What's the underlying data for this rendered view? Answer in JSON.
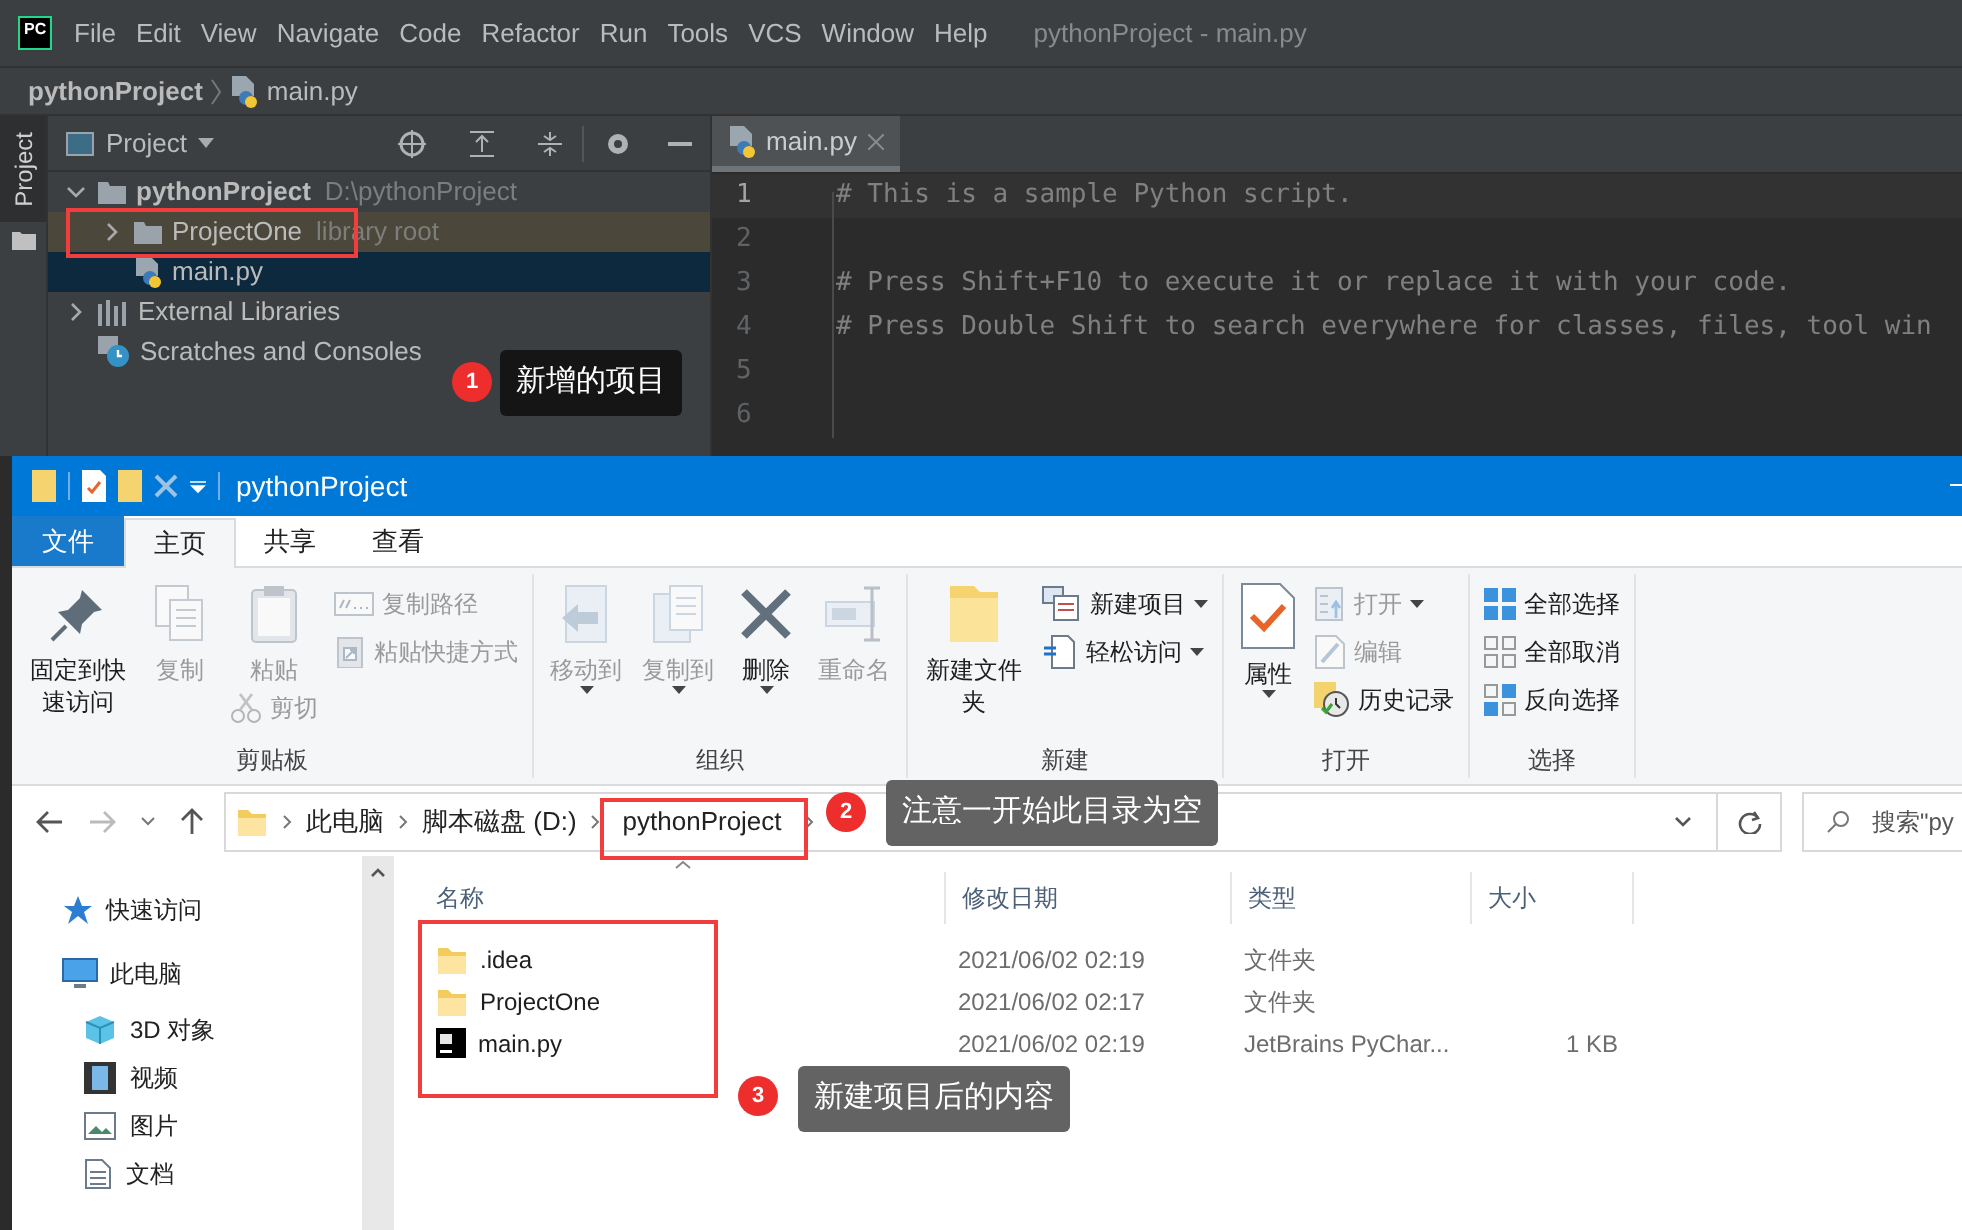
{
  "ide": {
    "logo": "PC",
    "menu": [
      "File",
      "Edit",
      "View",
      "Navigate",
      "Code",
      "Refactor",
      "Run",
      "Tools",
      "VCS",
      "Window",
      "Help"
    ],
    "title": "pythonProject - main.py",
    "breadcrumb": {
      "project": "pythonProject",
      "file": "main.py"
    },
    "side_tab": "Project",
    "project_panel": {
      "title": "Project",
      "tree": [
        {
          "label": "pythonProject",
          "hint": "D:\\pythonProject",
          "kind": "folder",
          "expanded": true,
          "selected": false,
          "highlighted": false,
          "children": [
            {
              "label": "ProjectOne",
              "hint": "library root",
              "kind": "folder",
              "expanded": false,
              "selected": false,
              "highlighted": true
            },
            {
              "label": "main.py",
              "kind": "python",
              "selected": true,
              "highlighted": false
            }
          ]
        },
        {
          "label": "External Libraries",
          "kind": "libraries",
          "expanded": false,
          "selected": false,
          "highlighted": false
        },
        {
          "label": "Scratches and Consoles",
          "kind": "scratches",
          "selected": false,
          "highlighted": false
        }
      ]
    },
    "editor": {
      "tab": "main.py",
      "lines": [
        {
          "number": "1",
          "code": "# This is a sample Python script.",
          "current": true
        },
        {
          "number": "2",
          "current": false
        },
        {
          "number": "3",
          "code": "# Press Shift+F10 to execute it or replace it with your code.",
          "current": false
        },
        {
          "number": "4",
          "code": "# Press Double Shift to search everywhere for classes, files, tool win",
          "current": false
        },
        {
          "number": "5",
          "current": false
        },
        {
          "number": "6",
          "current": false
        }
      ]
    }
  },
  "explorer": {
    "title": "pythonProject",
    "ribbon_tabs": [
      {
        "label": "文件",
        "kind": "menu",
        "selected": false
      },
      {
        "label": "主页",
        "kind": "tab",
        "selected": true
      },
      {
        "label": "共享",
        "kind": "tab",
        "selected": false
      },
      {
        "label": "查看",
        "kind": "tab",
        "selected": false
      }
    ],
    "ribbon_groups": [
      {
        "label": "剪贴板",
        "items": [
          {
            "label": "固定到快速访问",
            "kind": "large",
            "disabled": false
          },
          {
            "label": "复制",
            "kind": "large",
            "disabled": true
          },
          {
            "label": "粘贴",
            "kind": "large",
            "disabled": true
          },
          {
            "label": "剪切",
            "kind": "under",
            "disabled": true
          },
          {
            "label": "复制路径",
            "kind": "small",
            "disabled": true
          },
          {
            "label": "粘贴快捷方式",
            "kind": "small",
            "disabled": true
          }
        ]
      },
      {
        "label": "组织",
        "items": [
          {
            "label": "移动到",
            "kind": "large",
            "disabled": true,
            "dropdown": true
          },
          {
            "label": "复制到",
            "kind": "large",
            "disabled": true,
            "dropdown": true
          },
          {
            "label": "删除",
            "kind": "large",
            "disabled": false,
            "dropdown": true
          },
          {
            "label": "重命名",
            "kind": "large",
            "disabled": true
          }
        ]
      },
      {
        "label": "新建",
        "items": [
          {
            "label": "新建文件夹",
            "kind": "large",
            "disabled": false
          },
          {
            "label": "新建项目",
            "kind": "small",
            "disabled": false,
            "dropdown": true
          },
          {
            "label": "轻松访问",
            "kind": "small",
            "disabled": false,
            "dropdown": true
          }
        ]
      },
      {
        "label": "打开",
        "items": [
          {
            "label": "属性",
            "kind": "large",
            "disabled": false,
            "dropdown": true
          },
          {
            "label": "打开",
            "kind": "small",
            "disabled": true,
            "dropdown": true
          },
          {
            "label": "编辑",
            "kind": "small",
            "disabled": true
          },
          {
            "label": "历史记录",
            "kind": "small",
            "disabled": false
          }
        ]
      },
      {
        "label": "选择",
        "items": [
          {
            "label": "全部选择",
            "kind": "small",
            "disabled": false
          },
          {
            "label": "全部取消",
            "kind": "small",
            "disabled": false
          },
          {
            "label": "反向选择",
            "kind": "small",
            "disabled": false
          }
        ]
      }
    ],
    "address": [
      "此电脑",
      "脚本磁盘 (D:)",
      "pythonProject"
    ],
    "search": {
      "placeholder": "搜索\"py"
    },
    "nav": [
      {
        "label": "快速访问"
      },
      {
        "label": "此电脑",
        "children": [
          {
            "label": "3D 对象"
          },
          {
            "label": "视频"
          },
          {
            "label": "图片"
          },
          {
            "label": "文档"
          }
        ]
      }
    ],
    "columns": [
      "名称",
      "修改日期",
      "类型",
      "大小"
    ],
    "files": [
      {
        "name": ".idea",
        "modified": "2021/06/02 02:19",
        "type": "文件夹",
        "kind": "folder"
      },
      {
        "name": "ProjectOne",
        "modified": "2021/06/02 02:17",
        "type": "文件夹",
        "kind": "folder"
      },
      {
        "name": "main.py",
        "modified": "2021/06/02 02:19",
        "type": "JetBrains PyChar...",
        "size": "1 KB",
        "kind": "pycharm"
      }
    ]
  },
  "annotations": [
    {
      "number": "1",
      "text": "新增的项目"
    },
    {
      "number": "2",
      "text": "注意一开始此目录为空"
    },
    {
      "number": "3",
      "text": "新建项目后的内容"
    }
  ]
}
